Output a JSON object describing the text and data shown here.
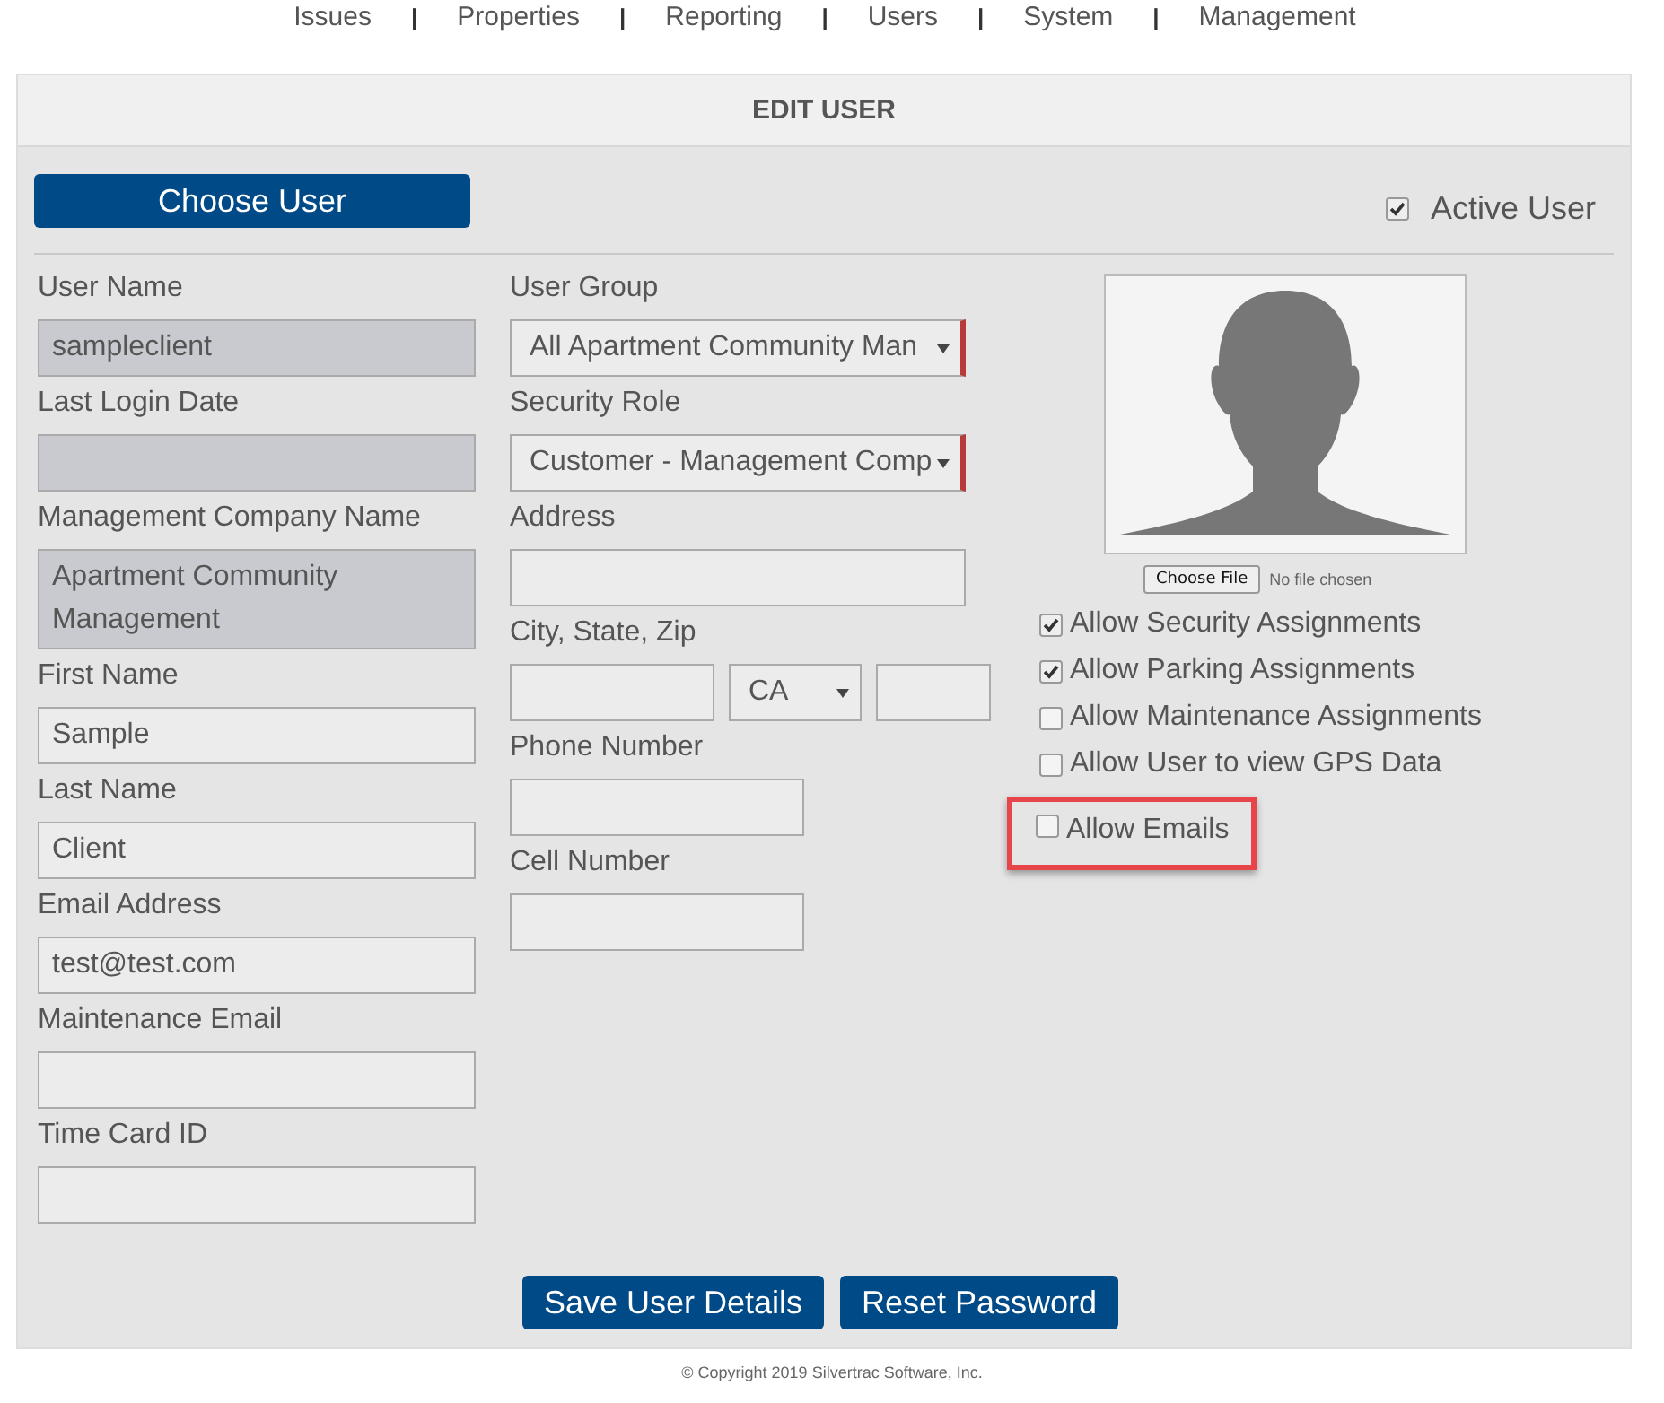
{
  "nav": [
    {
      "kind": "link",
      "text": "Issues"
    },
    {
      "kind": "separator",
      "text": "|"
    },
    {
      "kind": "link",
      "text": "Properties"
    },
    {
      "kind": "separator",
      "text": "|"
    },
    {
      "kind": "link",
      "text": "Reporting"
    },
    {
      "kind": "separator",
      "text": "|"
    },
    {
      "kind": "link",
      "text": "Users"
    },
    {
      "kind": "separator",
      "text": "|"
    },
    {
      "kind": "link",
      "text": "System"
    },
    {
      "kind": "separator",
      "text": "|"
    },
    {
      "kind": "link",
      "text": "Management"
    }
  ],
  "panel": {
    "title": "EDIT USER"
  },
  "choose_user": "Choose User",
  "active_user": {
    "label": "Active User",
    "checked": true
  },
  "left_fields": [
    {
      "label": "User Name",
      "kind": "readonly",
      "value": "sampleclient"
    },
    {
      "label": "Last Login Date",
      "kind": "readonly"
    },
    {
      "label": "Management Company Name",
      "kind": "readonly_multiline",
      "value": "Apartment Community Management"
    },
    {
      "label": "First Name",
      "kind": "input",
      "value": "Sample"
    },
    {
      "label": "Last Name",
      "kind": "input",
      "value": "Client"
    },
    {
      "label": "Email Address",
      "kind": "input",
      "value": "test@test.com"
    },
    {
      "label": "Maintenance Email",
      "kind": "input"
    },
    {
      "label": "Time Card ID",
      "kind": "input"
    }
  ],
  "middle_fields": [
    {
      "label": "User Group",
      "kind": "select",
      "value": "All Apartment Community Man"
    },
    {
      "label": "Security Role",
      "kind": "select",
      "value": "Customer - Management Comp"
    },
    {
      "label": "Address",
      "kind": "input"
    },
    {
      "label": "City, State, Zip",
      "kind": "city_state_zip",
      "state": "CA"
    },
    {
      "label": "Phone Number",
      "kind": "short_input"
    },
    {
      "label": "Cell Number",
      "kind": "short_input"
    }
  ],
  "photo": {
    "choose_file": "Choose File",
    "file_status": "No file chosen"
  },
  "permissions": [
    {
      "label": "Allow Security Assignments",
      "checked": true,
      "highlighted": false
    },
    {
      "label": "Allow Parking Assignments",
      "checked": true,
      "highlighted": false
    },
    {
      "label": "Allow Maintenance Assignments",
      "checked": false,
      "highlighted": false
    },
    {
      "label": "Allow User to view GPS Data",
      "checked": false,
      "highlighted": false
    },
    {
      "label": "Allow Emails",
      "checked": false,
      "highlighted": true
    }
  ],
  "buttons": [
    "Save User Details",
    "Reset Password"
  ],
  "footer": "© Copyright 2019 Silvertrac Software, Inc."
}
